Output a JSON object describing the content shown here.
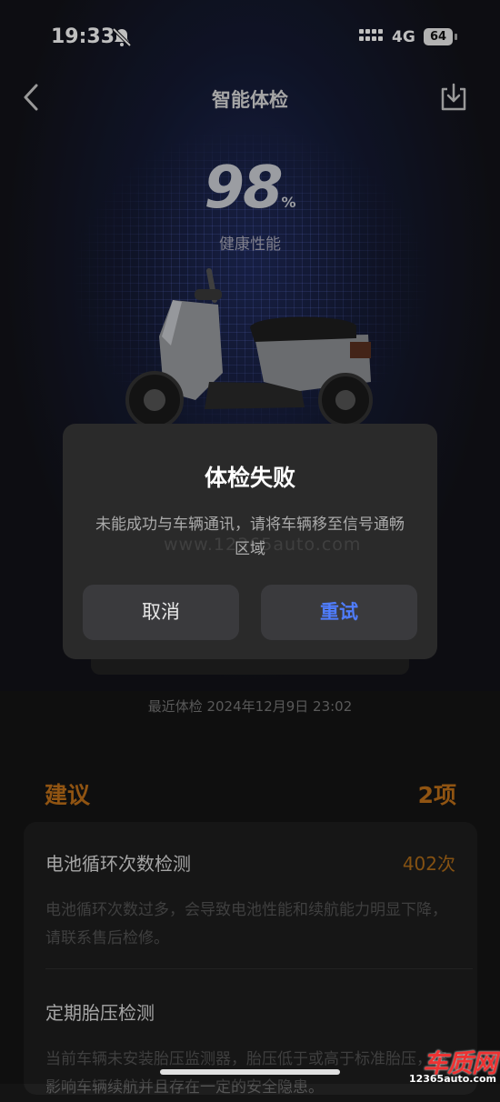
{
  "status_bar": {
    "time": "19:33",
    "network": "4G",
    "battery": "64"
  },
  "nav": {
    "title": "智能体检"
  },
  "score": {
    "value": "98",
    "unit": "%",
    "label": "健康性能"
  },
  "last_check": "最近体检 2024年12月9日 23:02",
  "dialog": {
    "title": "体检失败",
    "message": "未能成功与车辆通讯，请将车辆移至信号通畅区域",
    "cancel_label": "取消",
    "retry_label": "重试"
  },
  "watermark": "www.12365auto.com",
  "suggestions": {
    "title": "建议",
    "count": "2项",
    "items": [
      {
        "title": "电池循环次数检测",
        "value": "402次",
        "desc": "电池循环次数过多，会导致电池性能和续航能力明显下降，请联系售后检修。"
      },
      {
        "title": "定期胎压检测",
        "value": "",
        "desc": "当前车辆未安装胎压监测器，胎压低于或高于标准胎压，将影响车辆续航并且存在一定的安全隐患。"
      }
    ]
  },
  "logo": {
    "main": "车质网",
    "sub": "12365auto.com"
  },
  "colors": {
    "accent_blue": "#4f7dff",
    "accent_orange": "#c07018"
  }
}
